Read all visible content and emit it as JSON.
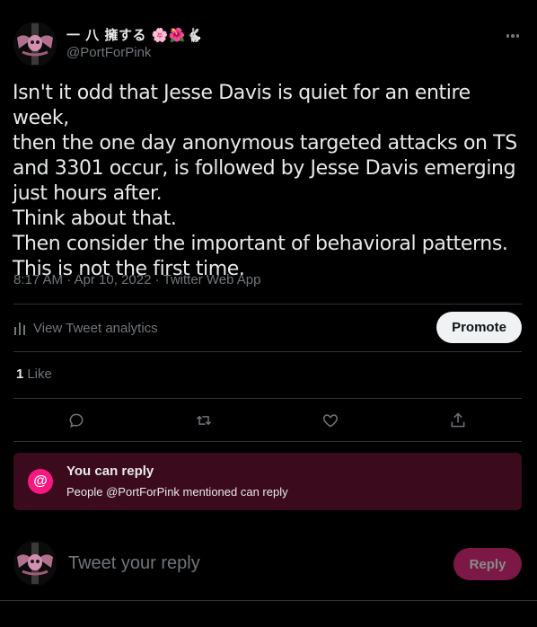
{
  "author": {
    "display_name": "一 八 擁する 🌸🌺🐇",
    "handle": "@PortForPink",
    "avatar_icon": "pink-skull-avatar-icon"
  },
  "tweet": {
    "text": "Isn't it odd that Jesse Davis is quiet for an entire week,\nthen the one day anonymous targeted attacks on TS\nand 3301 occur, is followed by Jesse Davis emerging\njust hours after.\nThink about that.\nThen consider the important of behavioral patterns.\nThis is not the first time.",
    "meta": "8:17 AM · Apr 10, 2022 · Twitter Web App"
  },
  "analytics": {
    "label": "View Tweet analytics",
    "promote_label": "Promote"
  },
  "likes": {
    "count": "1",
    "label": "Like"
  },
  "actions": [
    "reply-icon",
    "retweet-icon",
    "like-icon",
    "share-icon"
  ],
  "reply_restriction": {
    "title": "You can reply",
    "subtitle": "People @PortForPink mentioned can reply",
    "icon_text": "@"
  },
  "compose": {
    "placeholder": "Tweet your reply",
    "reply_label": "Reply"
  },
  "colors": {
    "background": "#000000",
    "accent_pink": "#f91880",
    "restriction_bg": "#3b0a1c",
    "reply_button_bg": "#7c1845"
  }
}
